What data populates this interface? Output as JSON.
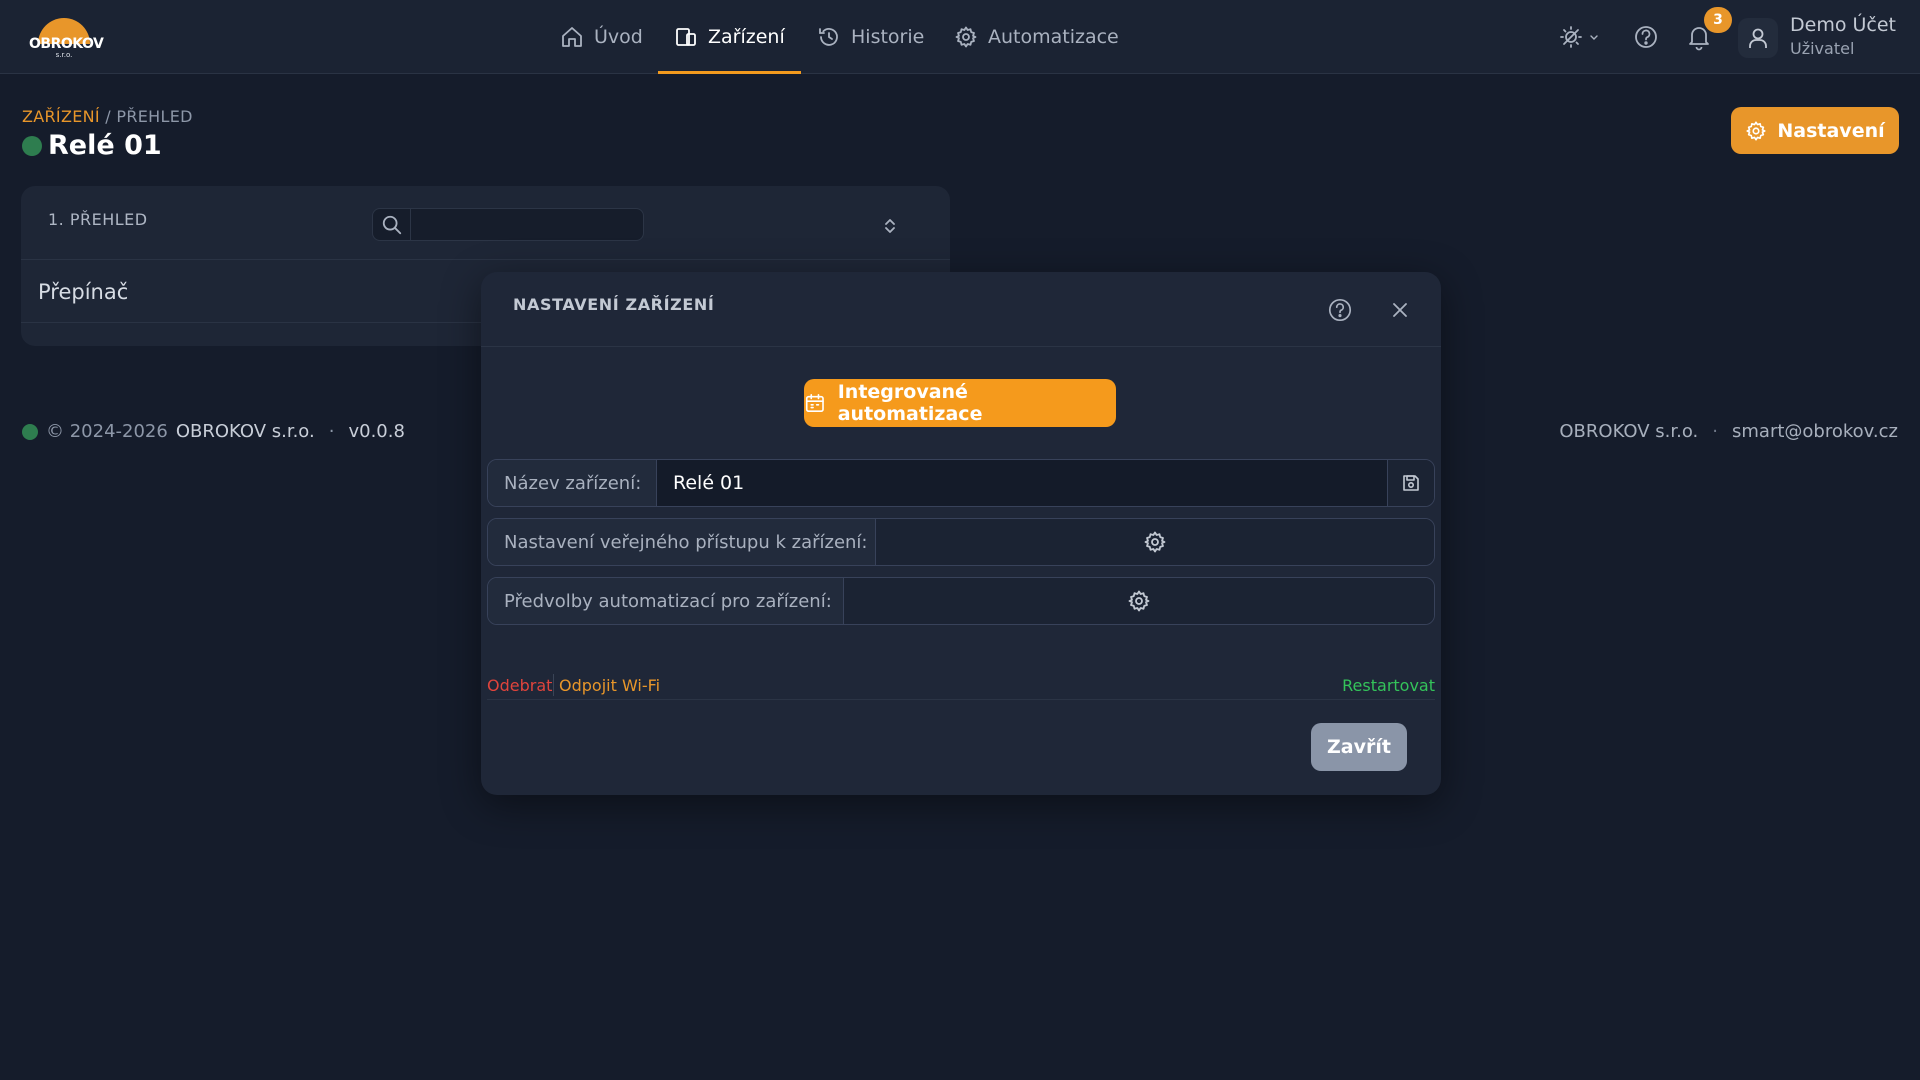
{
  "brand": {
    "logo_text": "OBROKOV",
    "logo_sub": "s.r.o."
  },
  "nav": {
    "items": [
      {
        "label": "Úvod",
        "icon": "home-icon"
      },
      {
        "label": "Zařízení",
        "icon": "devices-icon",
        "active": true
      },
      {
        "label": "Historie",
        "icon": "history-icon"
      },
      {
        "label": "Automatizace",
        "icon": "gear-icon"
      }
    ]
  },
  "topbar": {
    "theme_icon": "theme-toggle-icon",
    "help_icon": "help-icon",
    "notifications_count": "3",
    "user_name": "Demo Účet",
    "user_role": "Uživatel"
  },
  "page": {
    "breadcrumb_link": "ZAŘÍZENÍ",
    "breadcrumb_sep": "/",
    "breadcrumb_current": "PŘEHLED",
    "title": "Relé 01",
    "settings_label": "Nastavení"
  },
  "panel": {
    "title": "1. PŘEHLED",
    "search_value": "",
    "row_label": "Přepínač"
  },
  "footer": {
    "copyright": "© 2024-2026",
    "company": "OBROKOV s.r.o.",
    "dot": "·",
    "version": "v0.0.8",
    "right_company": "OBROKOV s.r.o.",
    "right_email": "smart@obrokov.cz"
  },
  "modal": {
    "title": "NASTAVENÍ ZAŘÍZENÍ",
    "auto_button": "Integrované automatizace",
    "name_label": "Název zařízení:",
    "name_value": "Relé 01",
    "public_label": "Nastavení veřejného přístupu k zařízení:",
    "presets_label": "Předvolby automatizací pro zařízení:",
    "remove_label": "Odebrat",
    "wifi_label": "Odpojit Wi-Fi",
    "restart_label": "Restartovat",
    "close_label": "Zavřít"
  },
  "colors": {
    "accent": "#f29a1e",
    "background": "#151c2b",
    "status_online": "#2e7d4f",
    "danger": "#e0443c",
    "warning": "#e8962a",
    "success": "#34c35a"
  }
}
